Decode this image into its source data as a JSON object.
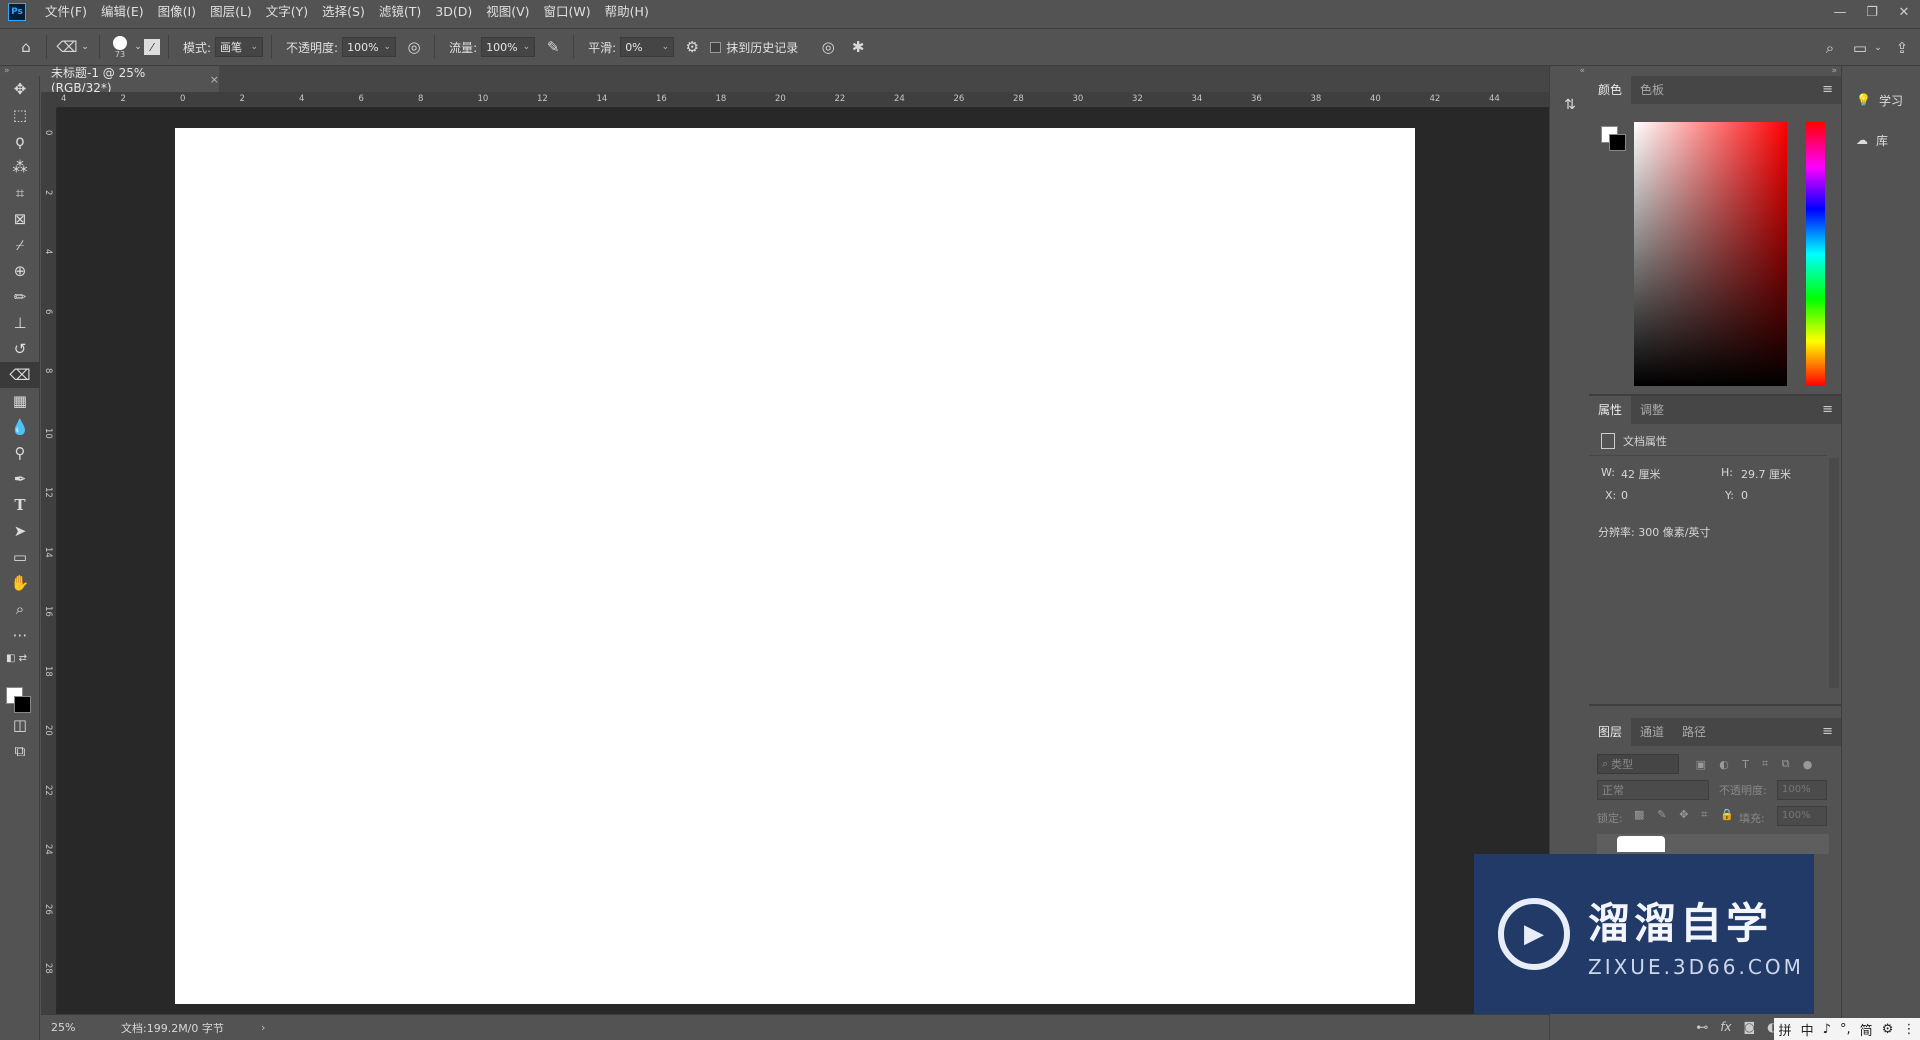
{
  "app": {
    "logo": "Ps"
  },
  "menu": [
    "文件(F)",
    "编辑(E)",
    "图像(I)",
    "图层(L)",
    "文字(Y)",
    "选择(S)",
    "滤镜(T)",
    "3D(D)",
    "视图(V)",
    "窗口(W)",
    "帮助(H)"
  ],
  "options": {
    "brush_size": "73",
    "mode_label": "模式:",
    "mode_value": "画笔",
    "opacity_label": "不透明度:",
    "opacity_value": "100%",
    "flow_label": "流量:",
    "flow_value": "100%",
    "smooth_label": "平滑:",
    "smooth_value": "0%",
    "erase_history_label": "抹到历史记录"
  },
  "document": {
    "tab_title": "未标题-1 @ 25%(RGB/32*)",
    "close_glyph": "×",
    "zoom": "25%",
    "doc_info": "文档:199.2M/0 字节",
    "ruler_h": [
      "4",
      "2",
      "0",
      "2",
      "4",
      "6",
      "8",
      "10",
      "12",
      "14",
      "16",
      "18",
      "20",
      "22",
      "24",
      "26",
      "28",
      "30",
      "32",
      "34",
      "36",
      "38",
      "40",
      "42",
      "44"
    ],
    "ruler_v": [
      "0",
      "2",
      "4",
      "6",
      "8",
      "10",
      "12",
      "14",
      "16",
      "18",
      "20",
      "22",
      "24",
      "26",
      "28"
    ]
  },
  "color_panel": {
    "tabs": [
      "颜色",
      "色板"
    ]
  },
  "properties_panel": {
    "tabs": [
      "属性",
      "调整"
    ],
    "title": "文档属性",
    "w_label": "W:",
    "w_value": "42 厘米",
    "h_label": "H:",
    "h_value": "29.7 厘米",
    "x_label": "X:",
    "x_value": "0",
    "y_label": "Y:",
    "y_value": "0",
    "resolution": "分辨率: 300 像素/英寸"
  },
  "layers_panel": {
    "tabs": [
      "图层",
      "通道",
      "路径"
    ],
    "search_placeholder": "类型",
    "blend_mode": "正常",
    "opacity_label": "不透明度:",
    "opacity_value": "100%",
    "lock_label": "锁定:",
    "fill_label": "填充:",
    "fill_value": "100%"
  },
  "right_dock": {
    "learn": "学习",
    "library": "库"
  },
  "watermark": {
    "title": "溜溜自学",
    "subtitle": "ZIXUE.3D66.COM"
  },
  "ime": {
    "items": [
      "拼",
      "中",
      "♪",
      "°,",
      "简",
      "⚙",
      "⋮"
    ]
  },
  "colors": {
    "panel_bg": "#535353",
    "canvas_bg": "#282828",
    "canvas": "#ffffff",
    "watermark_bg": "#213a68"
  }
}
